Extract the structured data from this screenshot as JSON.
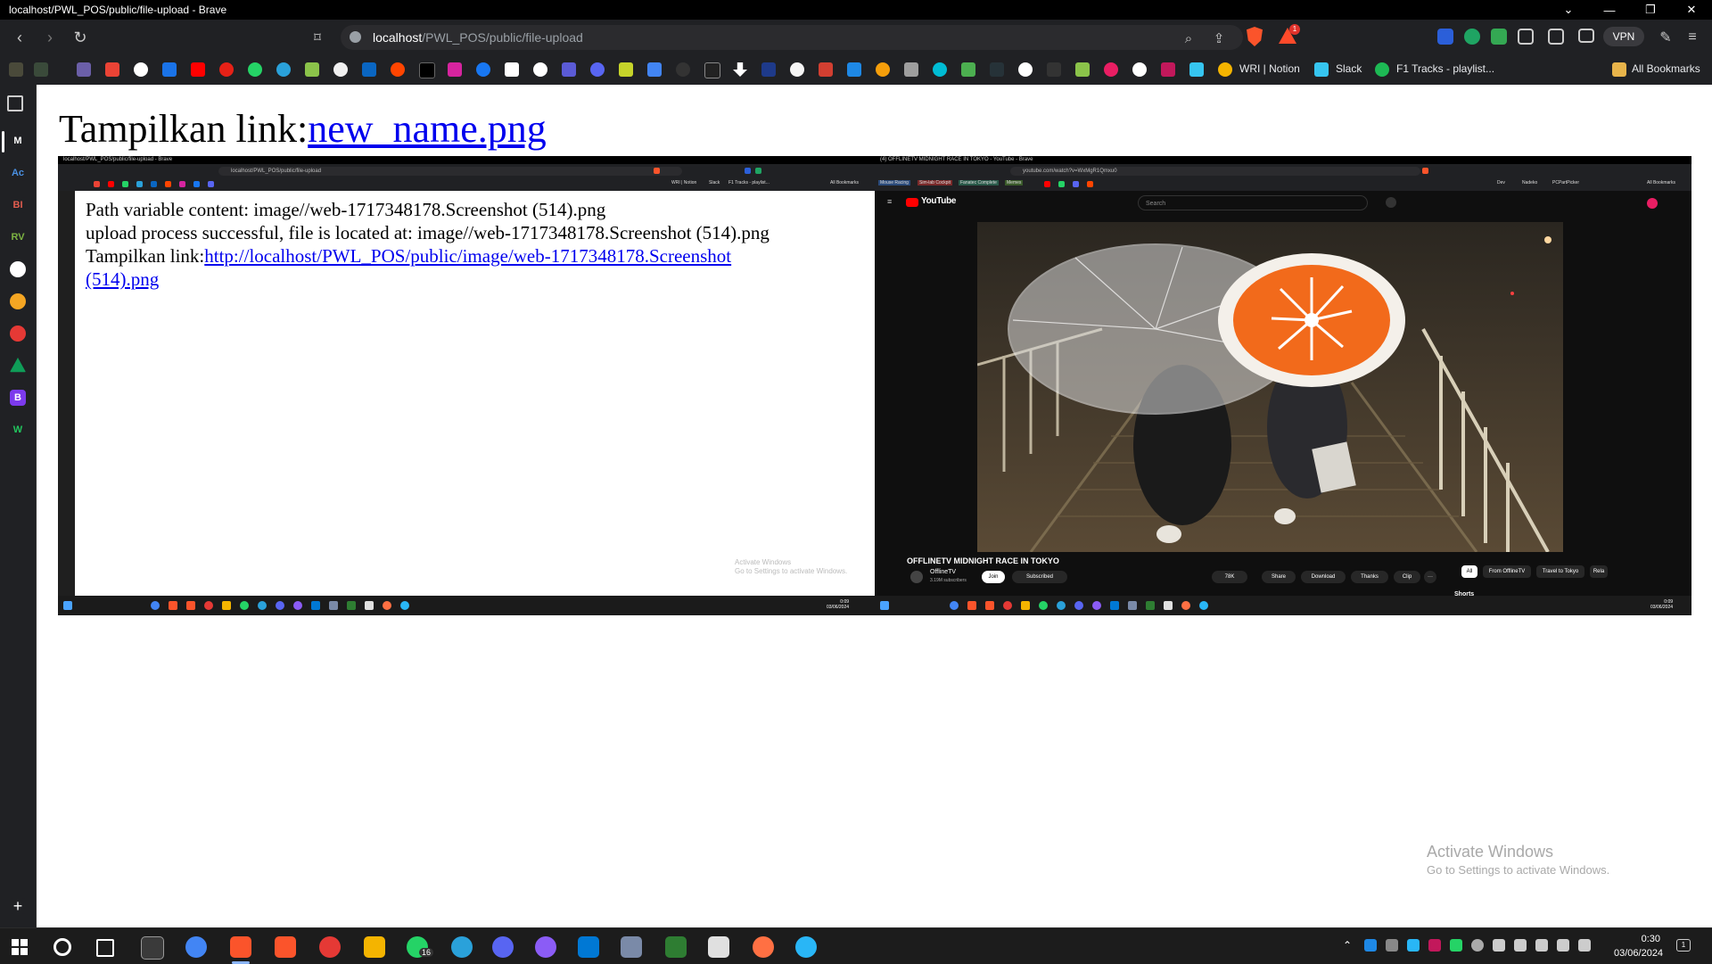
{
  "window": {
    "title": "localhost/PWL_POS/public/file-upload - Brave",
    "controls": {
      "menu": "⌄",
      "minimize": "—",
      "restore": "❐",
      "close": "✕"
    }
  },
  "navbar": {
    "url_host": "localhost",
    "url_path": "/PWL_POS/public/file-upload",
    "vpn_label": "VPN",
    "brave_rewards_badge": "1"
  },
  "bookmarks": {
    "wri_label": "WRI | Notion",
    "slack_label": "Slack",
    "f1_label": "F1 Tracks - playlist...",
    "all_bookmarks_label": "All Bookmarks"
  },
  "sidebar": {
    "items": [
      "M",
      "Ac",
      "BI",
      "RV",
      "",
      "",
      "",
      "",
      "B",
      "W"
    ],
    "add": "+"
  },
  "page": {
    "heading_prefix": "Tampilkan link:",
    "heading_link": "new_name.png"
  },
  "embedded": {
    "left": {
      "window_title": "localhost/PWL_POS/public/file-upload - Brave",
      "url": "localhost/PWL_POS/public/file-upload",
      "line1": "Path variable content: image//web-1717348178.Screenshot (514).png",
      "line2": "upload process successful, file is located at: image//web-1717348178.Screenshot (514).png",
      "line3_prefix": "Tampilkan link:",
      "line3_link_a": "http://localhost/PWL_POS/public/image/web-1717348178.Screenshot",
      "line3_link_b": "(514).png",
      "watermark_1": "Activate Windows",
      "watermark_2": "Go to Settings to activate Windows.",
      "bm_wri": "WRI | Notion",
      "bm_slack": "Slack",
      "bm_f1": "F1 Tracks - playlist...",
      "bm_all": "All Bookmarks",
      "clock_time": "0:09",
      "clock_date": "03/06/2024"
    },
    "right": {
      "window_title": "(4) OFFLINETV MIDNIGHT RACE IN TOKYO - YouTube - Brave",
      "url": "youtube.com/watch?v=WxMgR1Qmxu0",
      "bm_1": "Mouse Racing",
      "bm_2": "Sim-lab Cockpit",
      "bm_3": "Fanatec Complete",
      "bm_4": "Memes",
      "bm_dev": "Dev",
      "bm_nadeko": "Nadeko",
      "bm_pcpartpicker": "PCPartPicker",
      "bm_all": "All Bookmarks",
      "logo_text": "YouTube",
      "search_placeholder": "Search",
      "video_title": "OFFLINETV MIDNIGHT RACE IN TOKYO",
      "channel": "OfflineTV",
      "subscribers": "3.19M subscribers",
      "join": "Join",
      "subscribed": "Subscribed",
      "likes": "78K",
      "share": "Share",
      "download": "Download",
      "thanks": "Thanks",
      "clip": "Clip",
      "more": "···",
      "chip_all": "All",
      "chip_from": "From OfflineTV",
      "chip_travel": "Travel to Tokyo",
      "chip_rel": "Rela",
      "shorts": "Shorts",
      "clock_time": "0:09",
      "clock_date": "03/06/2024"
    }
  },
  "activate_windows": {
    "title": "Activate Windows",
    "subtitle": "Go to Settings to activate Windows."
  },
  "taskbar": {
    "whatsapp_badge": "16",
    "clock_time": "0:30",
    "clock_date": "03/06/2024",
    "notification_count": "1"
  },
  "colors": {
    "brave_orange": "#fb542b",
    "youtube_red": "#ff0000",
    "link_blue": "#0000ee",
    "browser_dark": "#202124"
  }
}
